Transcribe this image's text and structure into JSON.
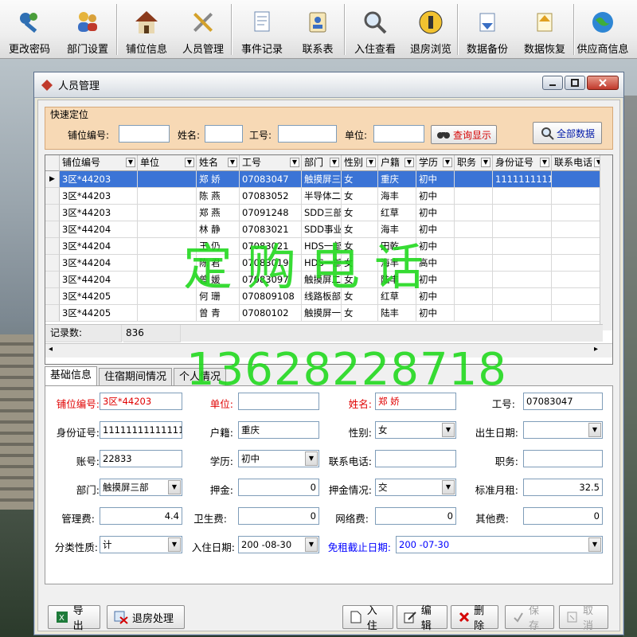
{
  "toolbar": {
    "items": [
      {
        "label": "更改密码",
        "icon": "keys-icon"
      },
      {
        "label": "部门设置",
        "icon": "users-icon"
      },
      {
        "label": "铺位信息",
        "icon": "house-icon"
      },
      {
        "label": "人员管理",
        "icon": "tools-icon"
      },
      {
        "label": "事件记录",
        "icon": "document-icon"
      },
      {
        "label": "联系表",
        "icon": "contact-card-icon"
      },
      {
        "label": "入住查看",
        "icon": "magnifier-icon"
      },
      {
        "label": "退房浏览",
        "icon": "exit-icon"
      },
      {
        "label": "数据备份",
        "icon": "backup-icon"
      },
      {
        "label": "数据恢复",
        "icon": "restore-icon"
      },
      {
        "label": "供应商信息",
        "icon": "globe-icon"
      }
    ]
  },
  "window": {
    "title": "人员管理"
  },
  "quick": {
    "legend": "快速定位",
    "berth_label": "铺位编号:",
    "name_label": "姓名:",
    "empno_label": "工号:",
    "unit_label": "单位:",
    "query_button": "查询显示",
    "all_button": "全部数据"
  },
  "grid": {
    "headers": [
      "铺位编号",
      "单位",
      "姓名",
      "工号",
      "部门",
      "性别",
      "户籍",
      "学历",
      "职务",
      "身份证号",
      "联系电话"
    ],
    "rows": [
      [
        "3区*44203",
        "",
        "郑 娇",
        "07083047",
        "触摸屏三",
        "女",
        "重庆",
        "初中",
        "",
        "11111111111",
        ""
      ],
      [
        "3区*44203",
        "",
        "陈 燕",
        "07083052",
        "半导体二",
        "女",
        "海丰",
        "初中",
        "",
        "",
        ""
      ],
      [
        "3区*44203",
        "",
        "郑 燕",
        "07091248",
        "SDD三部",
        "女",
        "红草",
        "初中",
        "",
        "",
        ""
      ],
      [
        "3区*44204",
        "",
        "林 静",
        "07083021",
        "SDD事业",
        "女",
        "海丰",
        "初中",
        "",
        "",
        ""
      ],
      [
        "3区*44204",
        "",
        "王 仍",
        "07083021",
        "HDS一部",
        "女",
        "田乾",
        "初中",
        "",
        "",
        ""
      ],
      [
        "3区*44204",
        "",
        "陈 君",
        "07083019",
        "HDS一部",
        "女",
        "海丰",
        "高中",
        "",
        "",
        ""
      ],
      [
        "3区*44204",
        "",
        "曾 媛",
        "07083097",
        "触摸屏二",
        "女",
        "陆丰",
        "初中",
        "",
        "",
        ""
      ],
      [
        "3区*44205",
        "",
        "何 珊",
        "070809108",
        "线路板部",
        "女",
        "红草",
        "初中",
        "",
        "",
        ""
      ],
      [
        "3区*44205",
        "",
        "曾 青",
        "07080102",
        "触摸屏一",
        "女",
        "陆丰",
        "初中",
        "",
        "",
        ""
      ]
    ],
    "record_label": "记录数:",
    "record_count": "836"
  },
  "tabs": [
    "基础信息",
    "住宿期间情况",
    "个人情况"
  ],
  "form": {
    "berth_label": "铺位编号:",
    "berth": "3区*44203",
    "unit_label": "单位:",
    "unit": "",
    "name_label": "姓名:",
    "name": "郑 娇",
    "empno_label": "工号:",
    "empno": "07083047",
    "id_label": "身份证号:",
    "id": "1111111111111111",
    "hukou_label": "户籍:",
    "hukou": "重庆",
    "gender_label": "性别:",
    "gender": "女",
    "birth_label": "出生日期:",
    "birth": "",
    "account_label": "账号:",
    "account": "22833",
    "edu_label": "学历:",
    "edu": "初中",
    "phone_label": "联系电话:",
    "phone": "",
    "duty_label": "职务:",
    "duty": "",
    "dept_label": "部门:",
    "dept": "触摸屏三部",
    "deposit_label": "押金:",
    "deposit": "0",
    "deposit_status_label": "押金情况:",
    "deposit_status": "交",
    "rent_label": "标准月租:",
    "rent": "32.5",
    "mgmt_label": "管理费:",
    "mgmt": "4.4",
    "hygiene_label": "卫生费:",
    "hygiene": "0",
    "net_label": "网络费:",
    "net": "0",
    "other_label": "其他费:",
    "other": "0",
    "category_label": "分类性质:",
    "category": "计",
    "checkin_label": "入住日期:",
    "checkin": "200 -08-30",
    "freerent_label": "免租截止日期:",
    "freerent": "200 -07-30"
  },
  "buttons": {
    "export": "导出",
    "checkout": "退房处理",
    "checkin": "入住",
    "edit": "编辑",
    "delete": "删除",
    "save": "保存",
    "cancel": "取消"
  },
  "watermark": {
    "line1": "定购电话",
    "line2": "13628228718"
  },
  "colors": {
    "selection": "#3b74d6",
    "quick_panel": "#f7d9b5",
    "watermark": "#22d91f",
    "required_label": "#e00000"
  }
}
